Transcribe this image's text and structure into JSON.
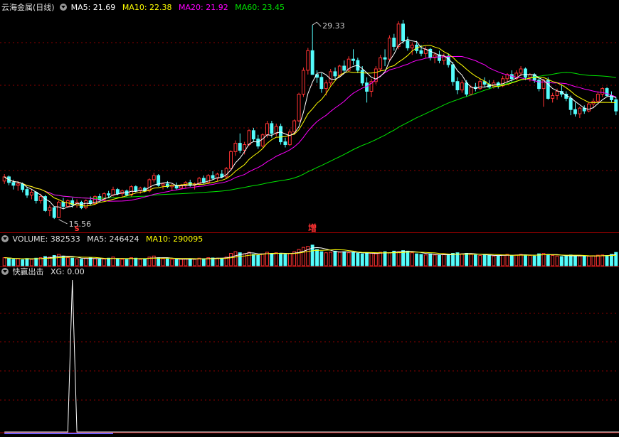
{
  "colors": {
    "up": "#ff3232",
    "down": "#54fcfc",
    "ma5": "#ffffff",
    "ma10": "#ffff00",
    "ma20": "#ff00ff",
    "ma60": "#00e600",
    "grid": "#8b0000",
    "separator": "#a00000",
    "label": "#c8c8c8",
    "signal": "#ffffff",
    "signal_base": "#7060ff"
  },
  "price_panel": {
    "stock_name": "云海金属(日线)",
    "ma5_label": "MA5: 21.69",
    "ma10_label": "MA10: 22.38",
    "ma20_label": "MA20: 21.92",
    "ma60_label": "MA60: 23.45"
  },
  "volume_panel": {
    "volume_label": "VOLUME: 382533",
    "ma5_label": "MA5: 246424",
    "ma10_label": "MA10: 290095"
  },
  "indicator_panel": {
    "name": "快赢出击",
    "xg_label": "XG: 0.00"
  },
  "chart_data": [
    {
      "type": "candlestick",
      "ylim": [
        15.0,
        30.0
      ],
      "annotations": [
        {
          "text": "29.33",
          "index": 68,
          "value": 29.33,
          "kind": "high"
        },
        {
          "text": "15.56",
          "index": 12,
          "value": 15.56,
          "kind": "low"
        },
        {
          "text": "S",
          "index": 16,
          "kind": "signal-marker"
        },
        {
          "text": "增",
          "index": 68,
          "kind": "signal-marker"
        }
      ],
      "candles": [
        [
          18.2,
          18.7,
          18.0,
          18.5
        ],
        [
          18.5,
          18.6,
          17.9,
          18.1
        ],
        [
          18.1,
          18.3,
          17.6,
          17.9
        ],
        [
          17.9,
          18.2,
          17.5,
          18.0
        ],
        [
          18.0,
          18.1,
          17.4,
          17.6
        ],
        [
          17.6,
          17.8,
          17.0,
          17.2
        ],
        [
          17.2,
          17.6,
          16.9,
          17.4
        ],
        [
          17.4,
          17.5,
          16.6,
          16.8
        ],
        [
          16.8,
          17.3,
          16.6,
          17.1
        ],
        [
          17.1,
          17.2,
          16.0,
          16.1
        ],
        [
          16.1,
          16.5,
          15.7,
          16.3
        ],
        [
          16.3,
          16.4,
          15.5,
          15.6
        ],
        [
          15.6,
          16.8,
          15.56,
          16.7
        ],
        [
          16.7,
          17.0,
          16.2,
          16.4
        ],
        [
          16.4,
          16.9,
          16.3,
          16.8
        ],
        [
          16.8,
          17.0,
          16.3,
          16.5
        ],
        [
          16.5,
          16.9,
          16.3,
          16.7
        ],
        [
          16.7,
          16.8,
          16.2,
          16.3
        ],
        [
          16.3,
          16.9,
          16.2,
          16.8
        ],
        [
          16.8,
          17.1,
          16.5,
          16.6
        ],
        [
          16.6,
          17.2,
          16.5,
          17.1
        ],
        [
          17.1,
          17.3,
          16.8,
          16.9
        ],
        [
          16.9,
          17.4,
          16.8,
          17.3
        ],
        [
          17.3,
          17.5,
          17.0,
          17.2
        ],
        [
          17.2,
          17.8,
          17.1,
          17.6
        ],
        [
          17.6,
          17.7,
          17.2,
          17.3
        ],
        [
          17.3,
          17.6,
          17.0,
          17.5
        ],
        [
          17.5,
          17.6,
          17.1,
          17.2
        ],
        [
          17.2,
          17.9,
          17.1,
          17.8
        ],
        [
          17.8,
          17.9,
          17.4,
          17.5
        ],
        [
          17.5,
          17.8,
          17.3,
          17.7
        ],
        [
          17.7,
          17.8,
          17.4,
          17.5
        ],
        [
          17.5,
          18.4,
          17.4,
          18.3
        ],
        [
          18.3,
          18.8,
          18.1,
          18.6
        ],
        [
          18.6,
          18.7,
          17.8,
          17.9
        ],
        [
          17.9,
          18.1,
          17.6,
          18.0
        ],
        [
          18.0,
          18.2,
          17.7,
          17.8
        ],
        [
          17.8,
          18.0,
          17.5,
          17.9
        ],
        [
          17.9,
          18.1,
          17.6,
          17.7
        ],
        [
          17.7,
          18.0,
          17.6,
          17.9
        ],
        [
          17.9,
          18.2,
          17.7,
          18.1
        ],
        [
          18.1,
          18.3,
          17.8,
          17.9
        ],
        [
          17.9,
          18.1,
          17.6,
          18.0
        ],
        [
          18.0,
          18.5,
          17.9,
          18.4
        ],
        [
          18.4,
          18.6,
          18.0,
          18.1
        ],
        [
          18.1,
          18.7,
          18.0,
          18.6
        ],
        [
          18.6,
          18.9,
          18.3,
          18.4
        ],
        [
          18.4,
          18.8,
          18.2,
          18.7
        ],
        [
          18.7,
          19.0,
          18.4,
          18.5
        ],
        [
          18.5,
          19.2,
          18.4,
          19.1
        ],
        [
          19.1,
          20.4,
          19.0,
          20.3
        ],
        [
          20.3,
          21.1,
          20.0,
          20.9
        ],
        [
          20.9,
          21.6,
          20.2,
          20.4
        ],
        [
          20.4,
          21.0,
          20.1,
          20.8
        ],
        [
          20.8,
          21.9,
          20.7,
          21.8
        ],
        [
          21.8,
          22.0,
          21.0,
          21.2
        ],
        [
          21.2,
          21.5,
          20.5,
          20.7
        ],
        [
          20.7,
          21.6,
          20.6,
          21.5
        ],
        [
          21.5,
          22.5,
          21.3,
          22.3
        ],
        [
          22.3,
          22.5,
          21.3,
          21.6
        ],
        [
          21.6,
          22.3,
          21.4,
          22.1
        ],
        [
          22.1,
          22.3,
          20.8,
          21.0
        ],
        [
          21.0,
          21.3,
          20.6,
          20.8
        ],
        [
          20.8,
          21.9,
          20.7,
          21.7
        ],
        [
          21.7,
          22.6,
          21.5,
          22.5
        ],
        [
          22.5,
          24.5,
          22.4,
          24.4
        ],
        [
          24.4,
          26.3,
          24.2,
          26.1
        ],
        [
          26.1,
          27.7,
          25.8,
          27.5
        ],
        [
          27.5,
          29.33,
          26.8,
          25.8
        ],
        [
          25.8,
          26.1,
          25.2,
          25.6
        ],
        [
          25.6,
          25.9,
          24.5,
          24.8
        ],
        [
          24.8,
          25.4,
          24.3,
          25.2
        ],
        [
          25.2,
          26.2,
          25.0,
          26.0
        ],
        [
          26.0,
          26.3,
          25.5,
          25.7
        ],
        [
          25.7,
          26.5,
          25.6,
          26.4
        ],
        [
          26.4,
          26.8,
          25.9,
          26.1
        ],
        [
          26.1,
          27.1,
          26.0,
          26.9
        ],
        [
          26.9,
          27.6,
          26.5,
          26.8
        ],
        [
          26.8,
          27.0,
          25.9,
          26.1
        ],
        [
          26.1,
          26.4,
          25.0,
          25.2
        ],
        [
          25.2,
          25.6,
          23.8,
          24.6
        ],
        [
          24.6,
          25.5,
          24.2,
          25.3
        ],
        [
          25.3,
          26.4,
          25.1,
          26.2
        ],
        [
          26.2,
          27.2,
          26.0,
          27.0
        ],
        [
          27.0,
          27.6,
          26.4,
          26.9
        ],
        [
          26.9,
          28.6,
          26.8,
          28.4
        ],
        [
          28.4,
          28.7,
          27.5,
          27.8
        ],
        [
          27.8,
          29.6,
          27.6,
          29.4
        ],
        [
          29.4,
          29.7,
          28.0,
          28.2
        ],
        [
          28.2,
          28.5,
          27.5,
          27.7
        ],
        [
          27.7,
          28.1,
          27.2,
          27.9
        ],
        [
          27.9,
          28.2,
          27.3,
          27.5
        ],
        [
          27.5,
          27.9,
          27.1,
          27.3
        ],
        [
          27.3,
          27.8,
          27.0,
          27.6
        ],
        [
          27.6,
          27.7,
          26.8,
          27.0
        ],
        [
          27.0,
          27.4,
          26.6,
          27.2
        ],
        [
          27.2,
          27.5,
          26.6,
          26.8
        ],
        [
          26.8,
          27.3,
          26.5,
          27.1
        ],
        [
          27.1,
          27.3,
          26.3,
          26.5
        ],
        [
          26.5,
          26.7,
          25.0,
          25.3
        ],
        [
          25.3,
          25.6,
          24.4,
          24.7
        ],
        [
          24.7,
          25.4,
          24.5,
          25.2
        ],
        [
          25.2,
          25.4,
          24.2,
          24.4
        ],
        [
          24.4,
          25.0,
          24.3,
          24.9
        ],
        [
          24.9,
          25.2,
          24.6,
          24.8
        ],
        [
          24.8,
          25.5,
          24.7,
          25.3
        ],
        [
          25.3,
          25.6,
          24.9,
          25.1
        ],
        [
          25.1,
          25.4,
          24.8,
          24.9
        ],
        [
          24.9,
          25.4,
          24.8,
          25.2
        ],
        [
          25.2,
          25.3,
          24.8,
          25.0
        ],
        [
          25.0,
          25.7,
          24.9,
          25.5
        ],
        [
          25.5,
          25.9,
          25.2,
          25.8
        ],
        [
          25.8,
          26.1,
          25.3,
          25.5
        ],
        [
          25.5,
          26.1,
          25.4,
          25.9
        ],
        [
          25.9,
          26.4,
          25.7,
          26.2
        ],
        [
          26.2,
          26.3,
          25.4,
          25.6
        ],
        [
          25.6,
          25.9,
          25.3,
          25.8
        ],
        [
          25.8,
          25.9,
          25.2,
          25.4
        ],
        [
          25.4,
          25.6,
          24.6,
          24.8
        ],
        [
          24.8,
          25.5,
          23.5,
          25.4
        ],
        [
          25.4,
          25.6,
          24.0,
          24.1
        ],
        [
          24.1,
          24.5,
          23.8,
          24.3
        ],
        [
          24.3,
          24.8,
          24.0,
          24.6
        ],
        [
          24.6,
          25.1,
          24.2,
          24.4
        ],
        [
          24.4,
          24.6,
          23.9,
          24.1
        ],
        [
          24.1,
          24.3,
          22.9,
          23.3
        ],
        [
          23.3,
          23.8,
          22.8,
          23.0
        ],
        [
          23.0,
          23.5,
          22.7,
          23.4
        ],
        [
          23.4,
          23.6,
          23.0,
          23.2
        ],
        [
          23.2,
          23.8,
          23.1,
          23.7
        ],
        [
          23.7,
          24.1,
          23.4,
          23.9
        ],
        [
          23.9,
          24.6,
          23.8,
          24.4
        ],
        [
          24.4,
          24.9,
          24.2,
          24.8
        ],
        [
          24.8,
          24.9,
          24.2,
          24.3
        ],
        [
          24.3,
          24.6,
          23.8,
          24.0
        ],
        [
          24.0,
          24.2,
          22.9,
          23.2
        ]
      ]
    },
    {
      "type": "bar",
      "name": "VOLUME",
      "ylim": [
        0,
        420000
      ],
      "values": [
        150000,
        140000,
        120000,
        130000,
        110000,
        135000,
        120000,
        140000,
        150000,
        170000,
        160000,
        190000,
        210000,
        170000,
        150000,
        140000,
        130000,
        120000,
        140000,
        150000,
        130000,
        120000,
        125000,
        140000,
        160000,
        130000,
        120000,
        115000,
        150000,
        140000,
        120000,
        125000,
        160000,
        180000,
        150000,
        130000,
        125000,
        120000,
        115000,
        120000,
        130000,
        125000,
        120000,
        140000,
        130000,
        150000,
        145000,
        140000,
        135000,
        160000,
        230000,
        260000,
        240000,
        220000,
        250000,
        210000,
        190000,
        220000,
        250000,
        230000,
        240000,
        220000,
        210000,
        230000,
        260000,
        300000,
        340000,
        360000,
        382533,
        300000,
        260000,
        240000,
        250000,
        270000,
        250000,
        260000,
        240000,
        250000,
        230000,
        220000,
        240000,
        230000,
        220000,
        250000,
        260000,
        240000,
        270000,
        260000,
        280000,
        270000,
        240000,
        220000,
        210000,
        200000,
        220000,
        200000,
        190000,
        210000,
        200000,
        230000,
        240000,
        220000,
        230000,
        210000,
        200000,
        190000,
        200000,
        190000,
        180000,
        185000,
        200000,
        210000,
        190000,
        200000,
        210000,
        200000,
        190000,
        180000,
        220000,
        230000,
        210000,
        190000,
        180000,
        170000,
        180000,
        200000,
        190000,
        180000,
        170000,
        175000,
        185000,
        195000,
        200000,
        190000,
        210000,
        246424
      ]
    },
    {
      "type": "line",
      "name": "XG",
      "ylim": [
        0,
        1
      ],
      "values_note_index_of_spike": 15,
      "values": [
        0,
        0,
        0,
        0,
        0,
        0,
        0,
        0,
        0,
        0,
        0,
        0,
        0,
        0,
        0,
        1,
        0,
        0,
        0,
        0,
        0,
        0,
        0,
        0,
        0,
        0,
        0,
        0,
        0,
        0,
        0,
        0,
        0,
        0,
        0,
        0,
        0,
        0,
        0,
        0,
        0,
        0,
        0,
        0,
        0,
        0,
        0,
        0,
        0,
        0,
        0,
        0,
        0,
        0,
        0,
        0,
        0,
        0,
        0,
        0,
        0,
        0,
        0,
        0,
        0,
        0,
        0,
        0,
        0,
        0,
        0,
        0,
        0,
        0,
        0,
        0,
        0,
        0,
        0,
        0,
        0,
        0,
        0,
        0,
        0,
        0,
        0,
        0,
        0,
        0,
        0,
        0,
        0,
        0,
        0,
        0,
        0,
        0,
        0,
        0,
        0,
        0,
        0,
        0,
        0,
        0,
        0,
        0,
        0,
        0,
        0,
        0,
        0,
        0,
        0,
        0,
        0,
        0,
        0,
        0,
        0,
        0,
        0,
        0,
        0,
        0,
        0,
        0,
        0,
        0,
        0,
        0,
        0,
        0,
        0,
        0,
        0
      ]
    }
  ]
}
